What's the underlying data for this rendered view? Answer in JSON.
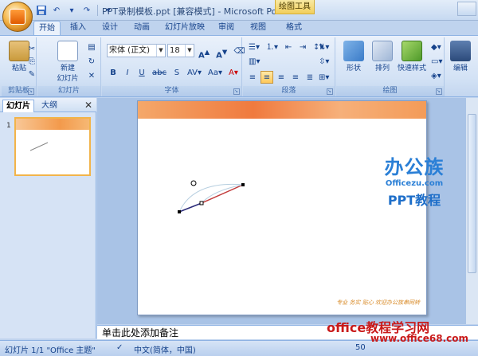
{
  "titlebar": {
    "title": "PPT录制模板.ppt [兼容模式] - Microsoft PowerP...",
    "context_tab": "绘图工具"
  },
  "tabs": [
    "开始",
    "插入",
    "设计",
    "动画",
    "幻灯片放映",
    "审阅",
    "视图",
    "格式"
  ],
  "ribbon": {
    "clipboard": {
      "label": "剪贴板",
      "paste": "粘贴"
    },
    "slides": {
      "label": "幻灯片",
      "new_slide_1": "新建",
      "new_slide_2": "幻灯片"
    },
    "font": {
      "label": "字体",
      "font_name": "宋体 (正文)",
      "font_size": "18"
    },
    "paragraph": {
      "label": "段落"
    },
    "drawing": {
      "label": "绘图",
      "shape": "形状",
      "arrange": "排列",
      "quick_style": "快速样式"
    },
    "editing": {
      "label": "编辑"
    }
  },
  "left_pane": {
    "tab_slides": "幻灯片",
    "tab_outline": "大纲",
    "slide_number": "1"
  },
  "slide": {
    "footer": "专业 务实 贴心 欢迎办公族串网转"
  },
  "watermark": {
    "logo": "办公族",
    "url": "Officezu.com",
    "subtitle": "PPT教程"
  },
  "notes": {
    "placeholder": "单击此处添加备注"
  },
  "statusbar": {
    "slide_info": "幻灯片 1/1   \"Office 主题\"",
    "language": "中文(简体，中国)",
    "zoom": "50"
  },
  "site_watermark": {
    "name": "office教程学习网",
    "url": "www.office68.com"
  }
}
